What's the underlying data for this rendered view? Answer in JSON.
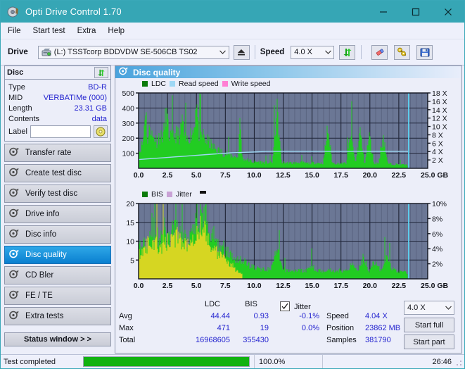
{
  "window": {
    "title": "Opti Drive Control 1.70",
    "app_icon": "disc-icon",
    "minimize": "—",
    "maximize": "□",
    "close": "✕",
    "titlebar_color": "#36a6b5"
  },
  "menu": {
    "items": [
      "File",
      "Start test",
      "Extra",
      "Help"
    ]
  },
  "toolbar": {
    "drive_label": "Drive",
    "drive_value": "(L:)  TSSTcorp BDDVDW SE-506CB TS02",
    "eject_icon": "eject-icon",
    "speed_label": "Speed",
    "speed_value": "4.0 X",
    "refresh_icon": "refresh-icon",
    "erase_icon": "eraser-icon",
    "tools_icon": "wrench-icon",
    "save_icon": "save-disk-icon"
  },
  "disc_panel": {
    "title": "Disc",
    "refresh_icon": "refresh-icon",
    "rows": [
      {
        "key": "Type",
        "value": "BD-R"
      },
      {
        "key": "MID",
        "value": "VERBATIMe (000)"
      },
      {
        "key": "Length",
        "value": "23.31 GB"
      },
      {
        "key": "Contents",
        "value": "data"
      }
    ],
    "label_key": "Label",
    "label_value": "",
    "label_button_icon": "disc-icon"
  },
  "sidebar": {
    "items": [
      {
        "label": "Transfer rate",
        "icon": "disc-test-icon",
        "selected": false
      },
      {
        "label": "Create test disc",
        "icon": "disc-test-icon",
        "selected": false
      },
      {
        "label": "Verify test disc",
        "icon": "disc-test-icon",
        "selected": false
      },
      {
        "label": "Drive info",
        "icon": "disc-test-icon",
        "selected": false
      },
      {
        "label": "Disc info",
        "icon": "disc-test-icon",
        "selected": false
      },
      {
        "label": "Disc quality",
        "icon": "disc-test-icon",
        "selected": true
      },
      {
        "label": "CD Bler",
        "icon": "disc-test-icon",
        "selected": false
      },
      {
        "label": "FE / TE",
        "icon": "disc-test-icon",
        "selected": false
      },
      {
        "label": "Extra tests",
        "icon": "disc-test-icon",
        "selected": false
      }
    ],
    "status_button": "Status window > >"
  },
  "main": {
    "header_title": "Disc quality",
    "header_icon": "disc-test-icon"
  },
  "stats": {
    "col_ldc": "LDC",
    "col_bis": "BIS",
    "row_avg": "Avg",
    "row_max": "Max",
    "row_total": "Total",
    "avg_ldc": "44.44",
    "avg_bis": "0.93",
    "max_ldc": "471",
    "max_bis": "19",
    "total_ldc": "16968605",
    "total_bis": "355430",
    "jitter_label": "Jitter",
    "jitter_checked": true,
    "jitter_avg": "-0.1%",
    "jitter_max": "0.0%",
    "speed_label": "Speed",
    "speed_value": "4.04 X",
    "position_label": "Position",
    "position_value": "23862 MB",
    "samples_label": "Samples",
    "samples_value": "381790",
    "speed_select": "4.0 X",
    "start_full": "Start full",
    "start_part": "Start part"
  },
  "statusbar": {
    "text": "Test completed",
    "percent_label": "100.0%",
    "progress": 100,
    "elapsed": "26:46",
    "progress_color": "#11b211"
  },
  "colors": {
    "ldc_green": "#22cc22",
    "bis_green": "#22cc22",
    "jitter_pink": "#c9a2d6",
    "read_speed": "#9fd8f5",
    "write_speed": "#ff7fd4",
    "plot_bg": "#6b7795",
    "grid": "#2a3142",
    "accent": "#2424cf"
  },
  "chart_data": [
    {
      "type": "area",
      "id": "ldc-chart",
      "title": "",
      "legend": [
        {
          "label": "LDC",
          "color": "#0a7a0a"
        },
        {
          "label": "Read speed",
          "color": "#9fd8f5"
        },
        {
          "label": "Write speed",
          "color": "#ff7fd4"
        }
      ],
      "legend_position": "top-left",
      "xlabel": "GB",
      "ylabel": "",
      "xlim": [
        0,
        25
      ],
      "ylim": [
        0,
        500
      ],
      "y2lim": [
        0,
        18
      ],
      "y2label": "X",
      "xticks": [
        "0.0",
        "2.5",
        "5.0",
        "7.5",
        "10.0",
        "12.5",
        "15.0",
        "17.5",
        "20.0",
        "22.5",
        "25.0 GB"
      ],
      "yticks": [
        100,
        200,
        300,
        400,
        500
      ],
      "y2ticks": [
        "2 X",
        "4 X",
        "6 X",
        "8 X",
        "10 X",
        "12 X",
        "14 X",
        "16 X",
        "18 X"
      ],
      "grid": true,
      "series": [
        {
          "name": "LDC",
          "color": "#22cc22",
          "kind": "area",
          "x": [
            0.0,
            0.2,
            0.4,
            0.6,
            0.8,
            1.0,
            1.2,
            1.4,
            1.6,
            1.8,
            2.0,
            2.2,
            2.4,
            2.6,
            2.8,
            3.0,
            3.2,
            3.4,
            3.6,
            3.8,
            4.0,
            4.2,
            4.4,
            4.6,
            4.8,
            5.0,
            5.2,
            5.4,
            5.6,
            5.8,
            6.0,
            6.2,
            6.4,
            6.6,
            6.8,
            7.0,
            7.2,
            7.4,
            7.6,
            7.8,
            8.0,
            8.2,
            8.4,
            8.6,
            8.8,
            9.0,
            9.2,
            9.4,
            9.6,
            9.8,
            10.0,
            10.4,
            10.8,
            11.2,
            11.6,
            12.0,
            12.4,
            12.8,
            13.2,
            13.6,
            14.0,
            14.4,
            14.8,
            15.2,
            15.6,
            16.0,
            16.4,
            16.8,
            17.2,
            17.6,
            18.0,
            18.4,
            18.8,
            19.2,
            19.6,
            20.0,
            20.4,
            20.8,
            21.2,
            21.6,
            22.0,
            22.4,
            22.8,
            23.3
          ],
          "values": [
            95,
            140,
            175,
            415,
            160,
            300,
            195,
            200,
            175,
            210,
            200,
            235,
            380,
            225,
            200,
            210,
            215,
            230,
            200,
            330,
            190,
            180,
            210,
            230,
            250,
            470,
            230,
            205,
            215,
            180,
            175,
            160,
            140,
            130,
            120,
            110,
            105,
            100,
            95,
            90,
            85,
            80,
            75,
            70,
            300,
            65,
            60,
            55,
            50,
            45,
            40,
            42,
            38,
            36,
            40,
            370,
            38,
            36,
            34,
            35,
            40,
            34,
            32,
            36,
            34,
            34,
            260,
            33,
            32,
            30,
            34,
            230,
            32,
            240,
            30,
            210,
            35,
            32,
            220,
            30,
            28,
            26,
            24,
            22
          ]
        },
        {
          "name": "Read speed",
          "color": "#9fd8f5",
          "kind": "line",
          "axis": "y2",
          "x": [
            0.0,
            1.0,
            2.0,
            3.0,
            4.0,
            5.0,
            6.0,
            7.0,
            8.0,
            9.0,
            10.0,
            11.0,
            12.0,
            14.0,
            16.0,
            18.0,
            20.0,
            22.0,
            23.3
          ],
          "values": [
            2.1,
            2.3,
            2.5,
            2.7,
            2.9,
            3.1,
            3.3,
            3.5,
            3.7,
            3.8,
            3.9,
            4.02,
            4.04,
            4.04,
            4.04,
            4.04,
            4.04,
            4.04,
            4.05
          ]
        }
      ],
      "cursor_x": 23.35,
      "cursor_color": "#5ad7f7"
    },
    {
      "type": "area",
      "id": "bis-chart",
      "title": "",
      "legend": [
        {
          "label": "BIS",
          "color": "#0a7a0a"
        },
        {
          "label": "Jitter",
          "color": "#c9a2d6"
        }
      ],
      "legend_position": "top-left",
      "xlabel": "GB",
      "ylabel": "",
      "xlim": [
        0,
        25
      ],
      "ylim": [
        0,
        20
      ],
      "y2lim": [
        0,
        10
      ],
      "y2label": "%",
      "xticks": [
        "0.0",
        "2.5",
        "5.0",
        "7.5",
        "10.0",
        "12.5",
        "15.0",
        "17.5",
        "20.0",
        "22.5",
        "25.0 GB"
      ],
      "yticks": [
        5,
        10,
        15,
        20
      ],
      "y2ticks": [
        "2%",
        "4%",
        "6%",
        "8%",
        "10%"
      ],
      "grid": true,
      "series": [
        {
          "name": "BIS",
          "color": "#22cc22",
          "kind": "area",
          "x": [
            0.0,
            0.2,
            0.4,
            0.6,
            0.8,
            1.0,
            1.2,
            1.4,
            1.6,
            1.8,
            2.0,
            2.2,
            2.4,
            2.6,
            2.8,
            3.0,
            3.2,
            3.4,
            3.6,
            3.8,
            4.0,
            4.2,
            4.4,
            4.6,
            4.8,
            5.0,
            5.2,
            5.4,
            5.6,
            5.8,
            6.0,
            6.2,
            6.4,
            6.6,
            6.8,
            7.0,
            7.2,
            7.4,
            7.6,
            7.8,
            8.0,
            8.4,
            8.8,
            9.2,
            9.6,
            10.0,
            10.5,
            11.0,
            11.5,
            12.0,
            12.5,
            13.0,
            13.5,
            14.0,
            14.5,
            15.0,
            15.5,
            16.0,
            16.5,
            17.0,
            17.5,
            18.0,
            18.5,
            19.0,
            19.5,
            20.0,
            20.5,
            21.0,
            21.5,
            22.0,
            22.5,
            23.0,
            23.3
          ],
          "values": [
            7.5,
            8.5,
            9.0,
            10.5,
            9.5,
            13.0,
            14.0,
            11.5,
            10.5,
            11.0,
            12.0,
            13.8,
            10.5,
            9.5,
            11.0,
            13.0,
            12.5,
            13.0,
            12.0,
            11.0,
            11.5,
            10.0,
            12.0,
            13.5,
            15.5,
            16.0,
            15.0,
            16.0,
            13.5,
            19.0,
            12.0,
            11.0,
            12.5,
            10.0,
            9.0,
            8.5,
            7.5,
            8.0,
            7.0,
            6.5,
            6.0,
            5.5,
            5.0,
            4.5,
            3.5,
            3.0,
            2.5,
            2.5,
            2.6,
            7.5,
            2.5,
            2.2,
            2.0,
            2.3,
            2.0,
            3.5,
            2.2,
            2.0,
            2.5,
            2.0,
            2.2,
            2.0,
            4.0,
            2.5,
            5.5,
            2.2,
            4.5,
            2.0,
            6.0,
            2.5,
            2.0,
            1.8,
            1.6
          ]
        },
        {
          "name": "Jitter",
          "color": "#d6d622",
          "kind": "area",
          "x": [
            0.0,
            0.5,
            1.0,
            1.5,
            2.0,
            2.5,
            3.0,
            3.5,
            4.0,
            4.5,
            5.0,
            5.5,
            6.0,
            6.5,
            7.0,
            7.5,
            8.0,
            8.5,
            9.0
          ],
          "values": [
            6.0,
            7.5,
            10.0,
            9.0,
            8.5,
            9.5,
            10.5,
            11.0,
            9.0,
            10.0,
            12.5,
            14.0,
            10.0,
            8.0,
            6.0,
            5.0,
            4.0,
            2.0,
            1.0
          ]
        }
      ],
      "cursor_x": 23.35,
      "cursor_color": "#5ad7f7"
    }
  ]
}
